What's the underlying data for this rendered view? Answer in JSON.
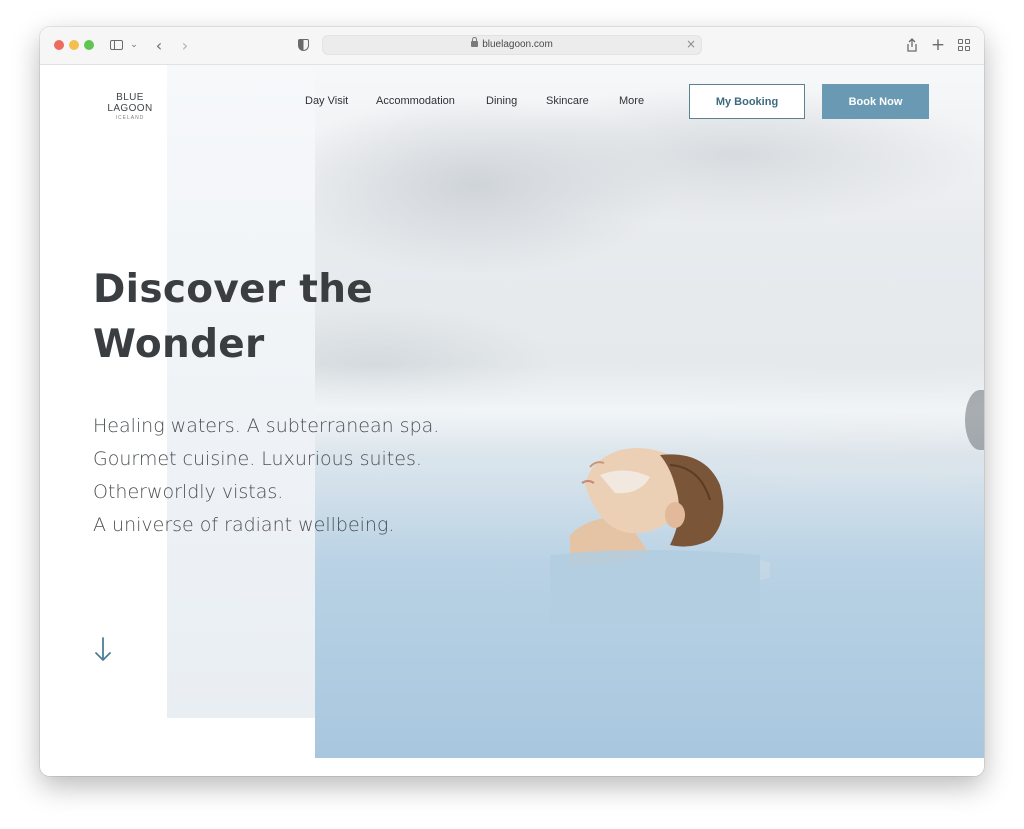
{
  "browser": {
    "url": "bluelagoon.com",
    "icons": [
      "sidebar-toggle-icon",
      "chevron-down-icon",
      "back-icon",
      "forward-icon",
      "shield-icon",
      "lock-icon",
      "close-icon",
      "share-icon",
      "plus-icon",
      "tabs-grid-icon"
    ],
    "glyphs": {
      "chevron": "⌄",
      "back": "‹",
      "forward": "›",
      "close": "×",
      "share": "⇪",
      "plus": "+"
    }
  },
  "site": {
    "logo_main": "BLUE LAGOON",
    "logo_sub": "ICELAND",
    "nav": [
      "Day Visit",
      "Accommodation",
      "Dining",
      "Skincare",
      "More"
    ],
    "my_booking_label": "My Booking",
    "book_now_label": "Book Now"
  },
  "hero": {
    "title": "Discover the Wonder",
    "lines": [
      "Healing waters. A subterranean spa.",
      "Gourmet cuisine. Luxurious suites.",
      "Otherworldly vistas.",
      "A universe of radiant wellbeing."
    ],
    "scroll_icon": "arrow-down-icon"
  },
  "colors": {
    "accent": "#6a9ab3",
    "accent_dark": "#3e6a80",
    "title_text": "#3a3e41",
    "panel": "#e9eef3",
    "water": "#a8c7df"
  }
}
